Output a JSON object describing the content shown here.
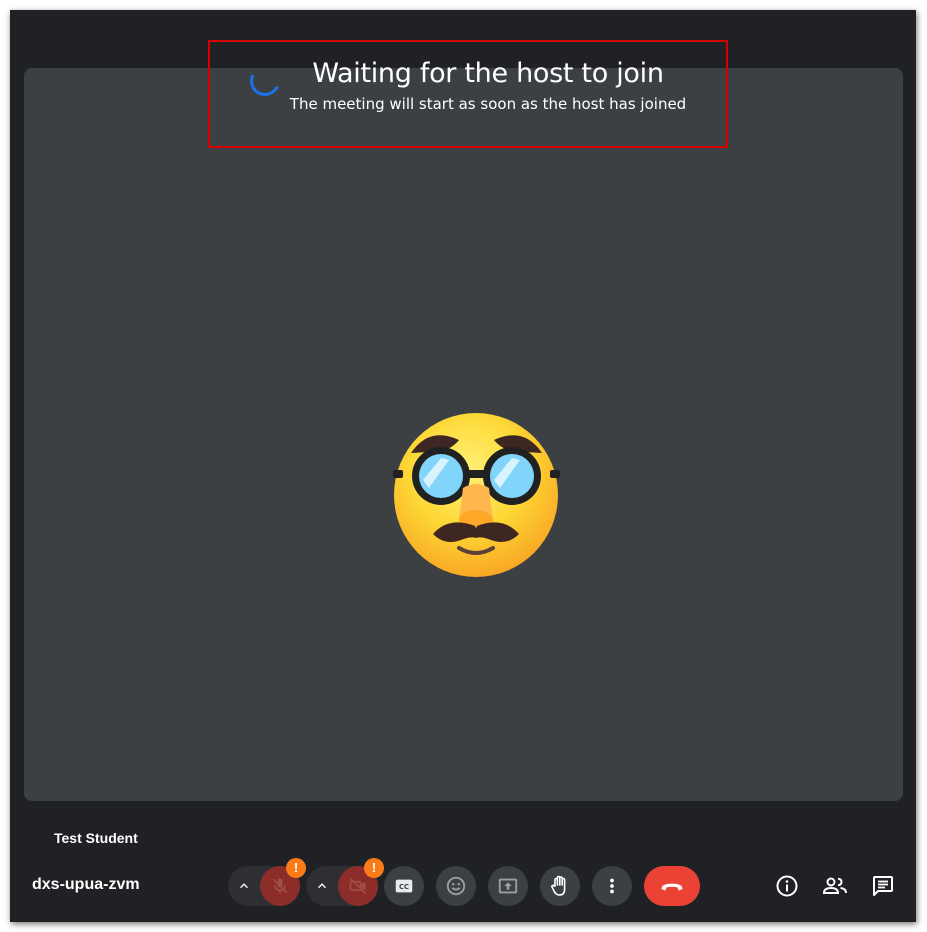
{
  "status": {
    "title": "Waiting for the host to join",
    "subtitle": "The meeting will start as soon as the host has joined"
  },
  "participant": {
    "name": "Test Student",
    "avatar_icon": "disguised-face-emoji"
  },
  "meeting": {
    "code": "dxs-upua-zvm"
  },
  "controls": {
    "microphone": {
      "icon": "mic-off-icon",
      "state": "muted",
      "warning": "!"
    },
    "camera": {
      "icon": "videocam-off-icon",
      "state": "off",
      "warning": "!"
    },
    "captions_icon": "closed-captions-icon",
    "reactions_icon": "emoji-reaction-icon",
    "present_icon": "present-screen-icon",
    "raise_hand_icon": "raise-hand-icon",
    "more_icon": "more-options-icon",
    "end_call_icon": "call-end-icon"
  },
  "side_actions": [
    "meeting-info-icon",
    "people-icon",
    "chat-icon"
  ],
  "colors": {
    "window_bg": "#202124",
    "stage_bg": "#3c4043",
    "muted_red": "#8c2d2a",
    "warning_orange": "#fa7b17",
    "end_call_red": "#ea4335",
    "spinner_blue": "#1a73e8",
    "highlight_border": "#d50000"
  }
}
